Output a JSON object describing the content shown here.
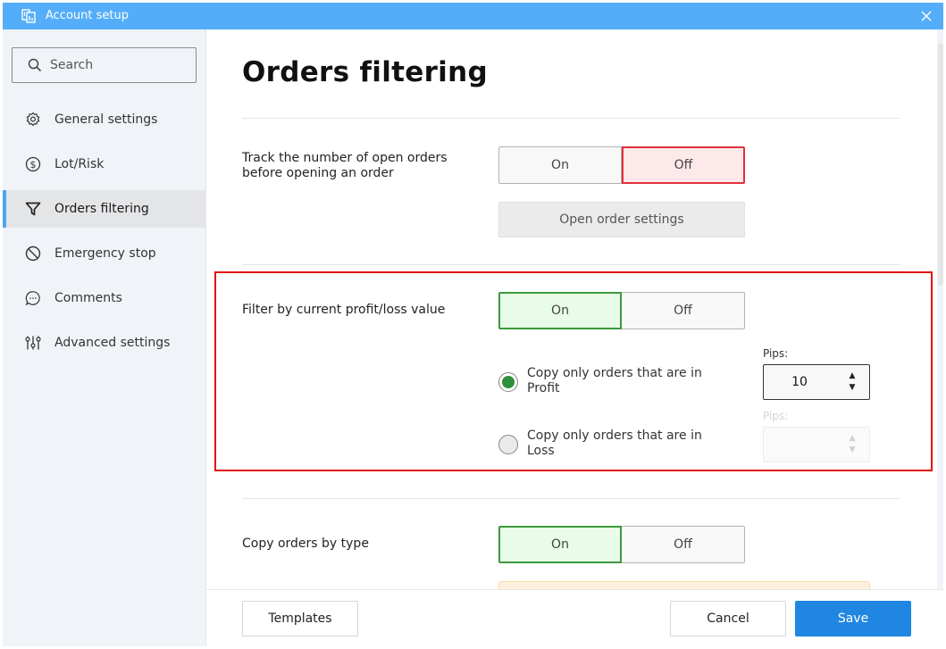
{
  "window": {
    "title": "Account setup",
    "app_icon": "copy-trade-icon",
    "close_icon": "close-icon",
    "accent_color": "#54adf8"
  },
  "sidebar": {
    "search": {
      "placeholder": "Search",
      "value": ""
    },
    "items": [
      {
        "label": "General settings",
        "icon": "gear-icon",
        "active": false
      },
      {
        "label": "Lot/Risk",
        "icon": "dollar-circle-icon",
        "active": false
      },
      {
        "label": "Orders filtering",
        "icon": "filter-icon",
        "active": true
      },
      {
        "label": "Emergency stop",
        "icon": "prohibited-icon",
        "active": false
      },
      {
        "label": "Comments",
        "icon": "chat-bubble-icon",
        "active": false
      },
      {
        "label": "Advanced settings",
        "icon": "sliders-icon",
        "active": false
      }
    ]
  },
  "main": {
    "title": "Orders filtering",
    "sections": [
      {
        "label": "Track the number of open orders before opening an order",
        "toggle": {
          "on_label": "On",
          "off_label": "Off",
          "value": "Off"
        },
        "button_label": "Open order settings"
      },
      {
        "label": "Filter by current profit/loss value",
        "toggle": {
          "on_label": "On",
          "off_label": "Off",
          "value": "On"
        },
        "options": [
          {
            "label": "Copy only orders that are in Profit",
            "checked": true,
            "pips_label": "Pips:",
            "pips_value": "10",
            "enabled": true
          },
          {
            "label": "Copy only orders that are in Loss",
            "checked": false,
            "pips_label": "Pips:",
            "pips_value": "",
            "enabled": false
          }
        ]
      },
      {
        "label": "Copy orders by type",
        "toggle": {
          "on_label": "On",
          "off_label": "Off",
          "value": "On"
        }
      }
    ]
  },
  "footer": {
    "templates_label": "Templates",
    "cancel_label": "Cancel",
    "save_label": "Save",
    "save_color": "#1f87e2"
  },
  "colors": {
    "on_active": "#3a9a3a",
    "off_active": "#e0303c",
    "highlight": "#e30b0b"
  }
}
